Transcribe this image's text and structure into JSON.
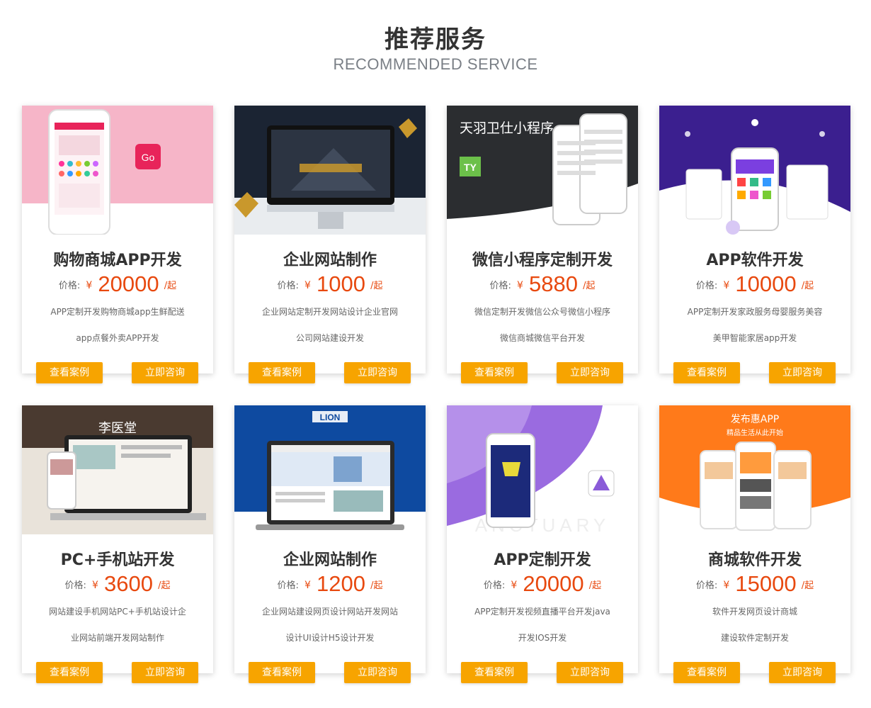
{
  "section": {
    "title": "推荐服务",
    "subtitle": "RECOMMENDED SERVICE"
  },
  "buttons": {
    "case_label": "查看案例",
    "consult_label": "立即咨询"
  },
  "price_label": "价格:",
  "currency": "¥",
  "unit": "/起",
  "cards": [
    {
      "name": "购物商城APP开发",
      "price": "20000",
      "desc_line1": "APP定制开发购物商城app生鲜配送",
      "desc_line2": "app点餐外卖APP开发",
      "thumb_icon": "shopping-app-phone-mockup",
      "thumb_colors": [
        "#f6b5c8",
        "#ffffff",
        "#e8245a"
      ]
    },
    {
      "name": "企业网站制作",
      "price": "1000",
      "desc_line1": "企业网站定制开发网站设计企业官网",
      "desc_line2": "公司网站建设开发",
      "thumb_icon": "desktop-monitor-mockup",
      "thumb_colors": [
        "#1b2433",
        "#d8dde3",
        "#c9982c"
      ]
    },
    {
      "name": "微信小程序定制开发",
      "price": "5880",
      "desc_line1": "微信定制开发微信公众号微信小程序",
      "desc_line2": "微信商城微信平台开发",
      "thumb_text": "天羽卫仕小程序",
      "thumb_icon": "mini-program-phones-mockup",
      "thumb_colors": [
        "#2b2d30",
        "#ffffff",
        "#6cc04a"
      ]
    },
    {
      "name": "APP软件开发",
      "price": "10000",
      "desc_line1": "APP定制开发家政服务母婴服务美容",
      "desc_line2": "美甲智能家居app开发",
      "thumb_icon": "app-stage-phones-mockup",
      "thumb_colors": [
        "#3b1f8f",
        "#7b3fe0",
        "#ffffff"
      ]
    },
    {
      "name": "PC+手机站开发",
      "price": "3600",
      "desc_line1": "网站建设手机网站PC+手机站设计企",
      "desc_line2": "业网站前端开发网站制作",
      "thumb_text": "李医堂",
      "thumb_icon": "laptop-phone-mockup",
      "thumb_colors": [
        "#4a3a30",
        "#e9e3da",
        "#ffffff"
      ]
    },
    {
      "name": "企业网站制作",
      "price": "1200",
      "desc_line1": "企业网站建设网页设计网站开发网站",
      "desc_line2": "设计UI设计H5设计开发",
      "thumb_text": "LION",
      "thumb_icon": "laptop-website-mockup",
      "thumb_colors": [
        "#0e4aa0",
        "#1a5fc0",
        "#2b2b2b"
      ]
    },
    {
      "name": "APP定制开发",
      "price": "20000",
      "desc_line1": "APP定制开发视频直播平台开发java",
      "desc_line2": "开发IOS开发",
      "thumb_text": "ANCTUARY",
      "thumb_icon": "music-app-phone-mockup",
      "thumb_colors": [
        "#9a6be0",
        "#c8a8f0",
        "#1c2a7a"
      ]
    },
    {
      "name": "商城软件开发",
      "price": "15000",
      "desc_line1": "软件开发网页设计商城",
      "desc_line2": "建设软件定制开发",
      "thumb_text": "发布惠APP",
      "thumb_text2": "精品生活从此开始",
      "thumb_icon": "shop-app-phones-mockup",
      "thumb_colors": [
        "#ff7a1a",
        "#ff9b3d",
        "#ffffff"
      ]
    }
  ]
}
